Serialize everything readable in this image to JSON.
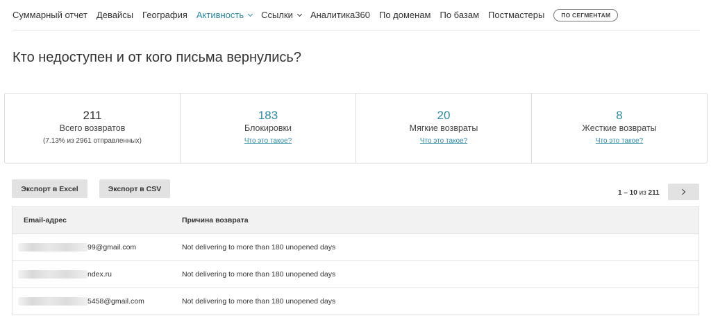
{
  "nav": {
    "items": [
      {
        "label": "Суммарный отчет",
        "active": false,
        "dropdown": false
      },
      {
        "label": "Девайсы",
        "active": false,
        "dropdown": false
      },
      {
        "label": "География",
        "active": false,
        "dropdown": false
      },
      {
        "label": "Активность",
        "active": true,
        "dropdown": true
      },
      {
        "label": "Ссылки",
        "active": false,
        "dropdown": true
      },
      {
        "label": "Аналитика360",
        "active": false,
        "dropdown": false
      },
      {
        "label": "По доменам",
        "active": false,
        "dropdown": false
      },
      {
        "label": "По базам",
        "active": false,
        "dropdown": false
      },
      {
        "label": "Постмастеры",
        "active": false,
        "dropdown": false
      }
    ],
    "pill_label": "ПО СЕГМЕНТАМ"
  },
  "page": {
    "title": "Кто недоступен и от кого письма вернулись?"
  },
  "stats": {
    "total": {
      "value": "211",
      "label": "Всего возвратов",
      "sub": "(7.13% из 2961 отправленных)"
    },
    "blocks": {
      "value": "183",
      "label": "Блокировки",
      "link": "Что это такое?"
    },
    "soft": {
      "value": "20",
      "label": "Мягкие возвраты",
      "link": "Что это такое?"
    },
    "hard": {
      "value": "8",
      "label": "Жесткие возвраты",
      "link": "Что это такое?"
    }
  },
  "actions": {
    "excel_label": "Экспорт в Excel",
    "csv_label": "Экспорт в CSV"
  },
  "pagination": {
    "range": "1 – 10",
    "of": "из",
    "total": "211"
  },
  "table": {
    "headers": [
      "Email-адрес",
      "Причина возврата"
    ],
    "rows": [
      {
        "email_visible": "99@gmail.com",
        "reason": "Not delivering to more than 180 unopened days"
      },
      {
        "email_visible": "ndex.ru",
        "reason": "Not delivering to more than 180 unopened days"
      },
      {
        "email_visible": "5458@gmail.com",
        "reason": "Not delivering to more than 180 unopened days"
      }
    ]
  },
  "colors": {
    "accent": "#2b8ba3",
    "button_bg": "#e2e2e2",
    "header_bg": "#f2f2f2"
  }
}
